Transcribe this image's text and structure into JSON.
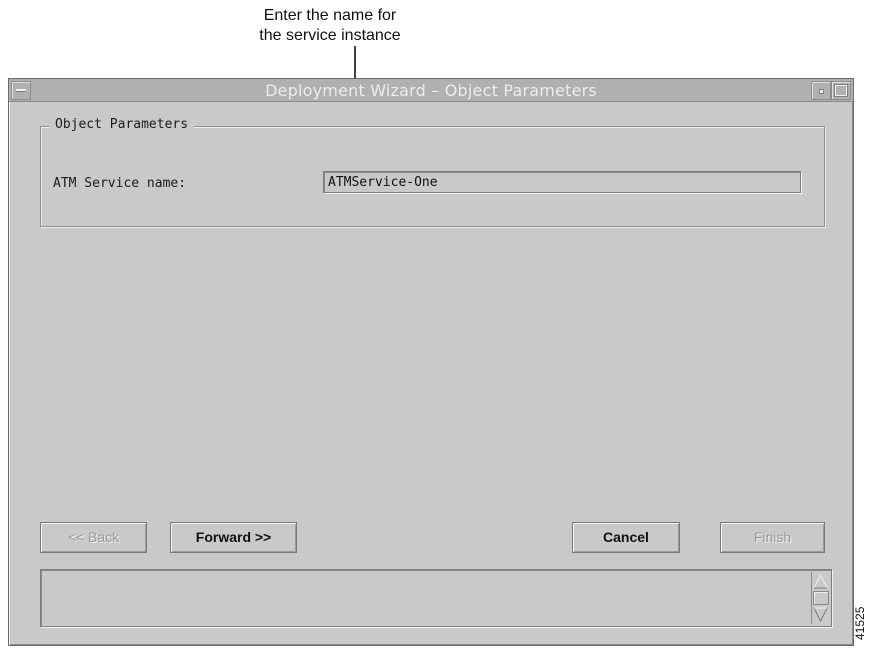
{
  "annotation": {
    "line1": "Enter the name for",
    "line2": "the service instance"
  },
  "window": {
    "title": "Deployment Wizard – Object Parameters",
    "menu_icon": "window-menu-icon",
    "minimize_icon": "window-minimize-icon",
    "maximize_icon": "window-maximize-icon"
  },
  "group": {
    "legend": "Object Parameters",
    "atm_service_label": "ATM Service name:",
    "atm_service_value": "ATMService-One"
  },
  "buttons": {
    "back": "<< Back",
    "forward": "Forward >>",
    "cancel": "Cancel",
    "finish": "Finish"
  },
  "status": {
    "scroll_up_icon": "scroll-up-arrow-icon",
    "scroll_down_icon": "scroll-down-arrow-icon"
  },
  "figure_id": "41525"
}
